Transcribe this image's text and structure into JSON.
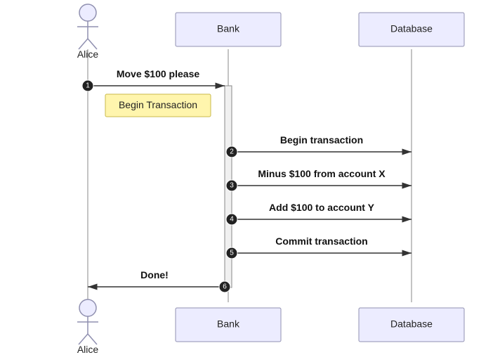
{
  "actor": {
    "name": "Alice"
  },
  "participants": {
    "bank": "Bank",
    "database": "Database"
  },
  "messages": {
    "m1": "Move $100 please",
    "m2": "Begin transaction",
    "m3": "Minus $100 from account X",
    "m4": "Add $100 to account Y",
    "m5": "Commit transaction",
    "m6": "Done!"
  },
  "note": "Begin Transaction",
  "seq": {
    "n1": "1",
    "n2": "2",
    "n3": "3",
    "n4": "4",
    "n5": "5",
    "n6": "6"
  },
  "chart_data": {
    "type": "sequence-diagram",
    "participants": [
      {
        "id": "alice",
        "label": "Alice",
        "kind": "actor"
      },
      {
        "id": "bank",
        "label": "Bank",
        "kind": "participant"
      },
      {
        "id": "database",
        "label": "Database",
        "kind": "participant"
      }
    ],
    "messages": [
      {
        "n": 1,
        "from": "alice",
        "to": "bank",
        "text": "Move $100 please",
        "note_after": "Begin Transaction"
      },
      {
        "n": 2,
        "from": "bank",
        "to": "database",
        "text": "Begin transaction"
      },
      {
        "n": 3,
        "from": "bank",
        "to": "database",
        "text": "Minus $100 from account X"
      },
      {
        "n": 4,
        "from": "bank",
        "to": "database",
        "text": "Add $100 to account Y"
      },
      {
        "n": 5,
        "from": "bank",
        "to": "database",
        "text": "Commit transaction"
      },
      {
        "n": 6,
        "from": "bank",
        "to": "alice",
        "text": "Done!"
      }
    ]
  }
}
